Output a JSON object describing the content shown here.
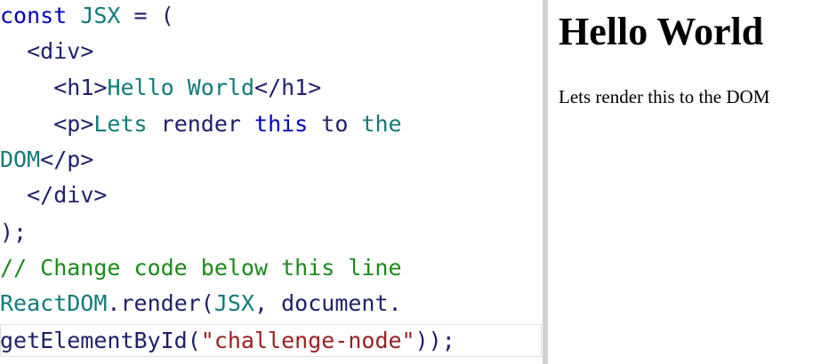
{
  "editor": {
    "line1": {
      "kw": "const",
      "name": "JSX",
      "rest": " = ("
    },
    "line2": {
      "indent": "  ",
      "open_div": "<div>"
    },
    "line3": {
      "indent": "    ",
      "open_h1": "<h1>",
      "text": "Hello World",
      "close_h1": "</h1>"
    },
    "line4": {
      "indent": "    ",
      "open_p": "<p>",
      "w1": "Lets",
      "w2": " render ",
      "w3": "this",
      "w4": " to ",
      "w5": "the"
    },
    "line5": {
      "w1": "DOM",
      "close_p": "</p>"
    },
    "line6": {
      "indent": "  ",
      "close_div": "</div>"
    },
    "line7": {
      "text": ");"
    },
    "line8": {
      "comment": "// Change code below this line"
    },
    "line9": {
      "obj": "ReactDOM",
      "dot": ".",
      "method": "render",
      "open": "(",
      "arg": "JSX",
      "comma": ", document."
    },
    "line10": {
      "method": "getElementById",
      "open": "(",
      "str": "\"challenge-node\"",
      "close": "));"
    }
  },
  "preview": {
    "heading": "Hello World",
    "paragraph": "Lets render this to the DOM"
  },
  "colors": {
    "keyword": "#0000c0",
    "identifier": "#117a7a",
    "tag": "#1f1f6b",
    "comment": "#1a8a1a",
    "string": "#9a1f1f"
  }
}
